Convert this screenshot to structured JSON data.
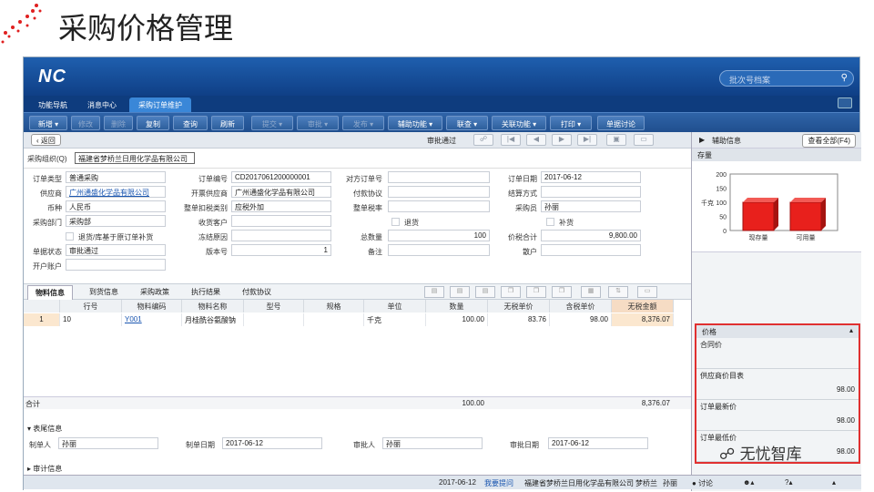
{
  "slide_title": "采购价格管理",
  "app": {
    "logo": "NC",
    "search_placeholder": "批次号档案"
  },
  "tabs": [
    "功能导航",
    "消息中心",
    "采购订单维护"
  ],
  "toolbar": [
    "新增 ▾",
    "修改",
    "删除",
    "复制",
    "查询",
    "刷新",
    "提交 ▾",
    "审批 ▾",
    "发布 ▾",
    "辅助功能 ▾",
    "联查 ▾",
    "关联功能 ▾",
    "打印 ▾",
    "单据讨论"
  ],
  "nav": {
    "back": "返回",
    "status": "审批通过"
  },
  "org": {
    "label": "采购组织(Q)",
    "value": "福建省梦桥兰日用化学品有限公司"
  },
  "form": {
    "order_type_label": "订单类型",
    "order_type": "普通采购",
    "supplier_label": "供应商",
    "supplier": "广州通盛化学品有限公司",
    "currency_label": "币种",
    "currency": "人民币",
    "dept_label": "采购部门",
    "dept": "采购部",
    "return_label": "退货/库基于原订单补货",
    "bill_status_label": "单据状态",
    "bill_status": "审批通过",
    "bank_label": "开户账户",
    "order_no_label": "订单编号",
    "order_no": "CD2017061200000001",
    "invoice_supplier_label": "开票供应商",
    "invoice_supplier": "广州通盛化学品有限公司",
    "tax_label": "整单扣税类别",
    "tax": "应税外加",
    "receiver_label": "收货客户",
    "freeze_label": "冻结原因",
    "version_label": "版本号",
    "version": "1",
    "counter_label": "对方订单号",
    "pay_label": "付款协议",
    "rate_label": "整单税率",
    "return2_label": "退货",
    "qty_label": "总数量",
    "qty": "100",
    "note_label": "备注",
    "date_label": "订单日期",
    "date": "2017-06-12",
    "settle_label": "结算方式",
    "buyer_label": "采购员",
    "buyer": "孙丽",
    "replenish_label": "补货",
    "total_label": "价税合计",
    "total": "9,800.00",
    "account_label": "散户"
  },
  "subtabs": [
    "物料信息",
    "到货信息",
    "采购政策",
    "执行结果",
    "付款协议"
  ],
  "grid": {
    "headers": [
      "行号",
      "物料编码",
      "物料名称",
      "型号",
      "规格",
      "单位",
      "数量",
      "无税单价",
      "含税单价",
      "无税金额"
    ],
    "row": [
      "1",
      "10",
      "Y001",
      "月桂酰谷氨酸钠",
      "",
      "",
      "千克",
      "100.00",
      "83.76",
      "98.00",
      "8,376.07"
    ],
    "sum_label": "合计",
    "sum_qty": "100.00",
    "sum_amount": "8,376.07"
  },
  "tail": {
    "section": "表尾信息",
    "maker_label": "制单人",
    "maker": "孙丽",
    "make_date_label": "制单日期",
    "make_date": "2017-06-12",
    "approver_label": "审批人",
    "approver": "孙丽",
    "approve_date_label": "审批日期",
    "approve_date": "2017-06-12",
    "audit": "审计信息"
  },
  "statusbar": {
    "date": "2017-06-12",
    "hint": "我要提问",
    "company": "福建省梦桥兰日用化学品有限公司",
    "user1": "梦桥兰",
    "user2": "孙丽",
    "discuss": "讨论"
  },
  "side": {
    "title": "辅助信息",
    "view_all": "查看全部(F4)",
    "stock": "存量",
    "price": "价格",
    "items": [
      {
        "label": "合同价",
        "value": ""
      },
      {
        "label": "供应商价目表",
        "value": "98.00"
      },
      {
        "label": "订单最新价",
        "value": "98.00"
      },
      {
        "label": "订单最低价",
        "value": "98.00"
      }
    ]
  },
  "chart_data": {
    "type": "bar",
    "categories": [
      "现存量",
      "可用量"
    ],
    "values": [
      100,
      100
    ],
    "ylabel": "千克",
    "ylim": [
      0,
      200
    ],
    "yticks": [
      0,
      50,
      100,
      150,
      200
    ],
    "color": "#e8201c"
  },
  "watermark": "无忧智库"
}
